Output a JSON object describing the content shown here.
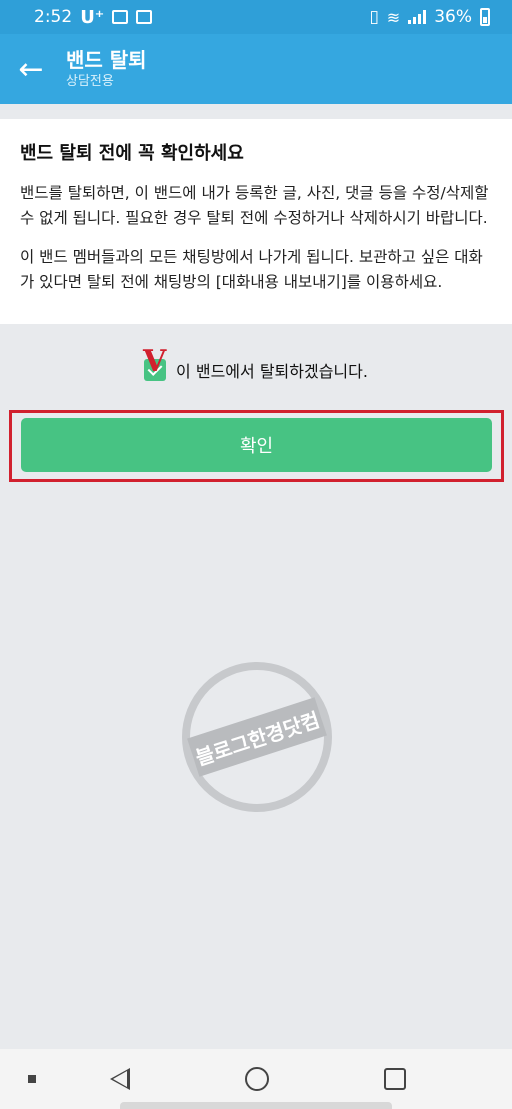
{
  "status_bar": {
    "time": "2:52",
    "carrier": "U⁺",
    "battery": "36%"
  },
  "header": {
    "title": "밴드 탈퇴",
    "subtitle": "상담전용"
  },
  "notice": {
    "heading": "밴드 탈퇴 전에 꼭 확인하세요",
    "paragraph1": "밴드를 탈퇴하면, 이 밴드에 내가 등록한 글, 사진, 댓글 등을 수정/삭제할 수 없게 됩니다. 필요한 경우 탈퇴 전에 수정하거나 삭제하시기 바랍니다.",
    "paragraph2": "이 밴드 멤버들과의 모든 채팅방에서 나가게 됩니다. 보관하고 싶은 대화가 있다면 탈퇴 전에 채팅방의 [대화내용 내보내기]를 이용하세요."
  },
  "agree": {
    "label": "이 밴드에서 탈퇴하겠습니다.",
    "checked": true,
    "annotation": "V"
  },
  "confirm_button": {
    "label": "확인"
  },
  "watermark": {
    "text": "블로그한경닷컴"
  },
  "icons": {
    "back": "back-arrow-icon",
    "home": "home-icon",
    "recent": "recent-apps-icon"
  },
  "colors": {
    "header": "#35a7e0",
    "status_bar": "#2f9fd8",
    "accent_green": "#47c383",
    "highlight_red": "#d1202e"
  }
}
